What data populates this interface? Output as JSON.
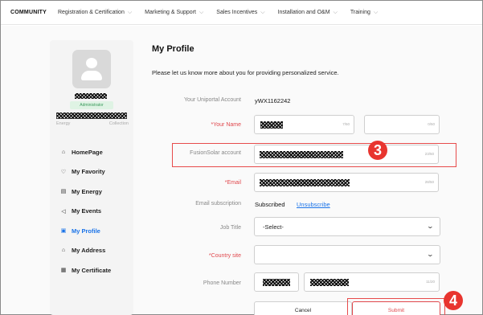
{
  "nav": {
    "brand": "COMMUNITY",
    "items": [
      {
        "label": "Registration & Certification"
      },
      {
        "label": "Marketing & Support"
      },
      {
        "label": "Sales Incentives"
      },
      {
        "label": "Installation and O&M"
      },
      {
        "label": "Training"
      }
    ]
  },
  "profile_card": {
    "role_badge": "Administrator",
    "stats": {
      "left": "Energy",
      "right": "Collection"
    }
  },
  "sidebar": {
    "items": [
      {
        "label": "HomePage",
        "icon": "home-icon",
        "glyph": "⌂"
      },
      {
        "label": "My Favority",
        "icon": "heart-icon",
        "glyph": "♡"
      },
      {
        "label": "My Energy",
        "icon": "battery-icon",
        "glyph": "▤"
      },
      {
        "label": "My Events",
        "icon": "megaphone-icon",
        "glyph": "◁"
      },
      {
        "label": "My Profile",
        "icon": "profile-icon",
        "glyph": "▣"
      },
      {
        "label": "My Address",
        "icon": "address-icon",
        "glyph": "⌂"
      },
      {
        "label": "My Certificate",
        "icon": "certificate-icon",
        "glyph": "▦"
      }
    ],
    "active_index": 4
  },
  "page": {
    "title": "My Profile",
    "subtitle": "Please let us know more about you for providing personalized service."
  },
  "form": {
    "uniportal": {
      "label": "Your Uniportal Account",
      "value": "yWX1162242"
    },
    "name": {
      "label": "*Your Name",
      "count1": "7/50",
      "count2": "0/50"
    },
    "fusionsolar": {
      "label": "FusionSolar account",
      "count": "23/50"
    },
    "email": {
      "label": "*Email",
      "count": "28/50"
    },
    "subscription": {
      "label": "Email subscription",
      "status": "Subscribed",
      "action": "Unsubscribe"
    },
    "job_title": {
      "label": "Job Title",
      "selected": "-Select-"
    },
    "country": {
      "label": "*Country site",
      "selected": ""
    },
    "phone": {
      "label": "Phone Number",
      "count": "11/20"
    },
    "cancel": "Cancel",
    "submit": "Submit"
  },
  "annotations": {
    "step3": "3",
    "step4": "4",
    "color": "#e8352f"
  },
  "colors": {
    "accent": "#1a73e8",
    "required": "#e0484d",
    "badge_bg": "#dff3e4"
  }
}
